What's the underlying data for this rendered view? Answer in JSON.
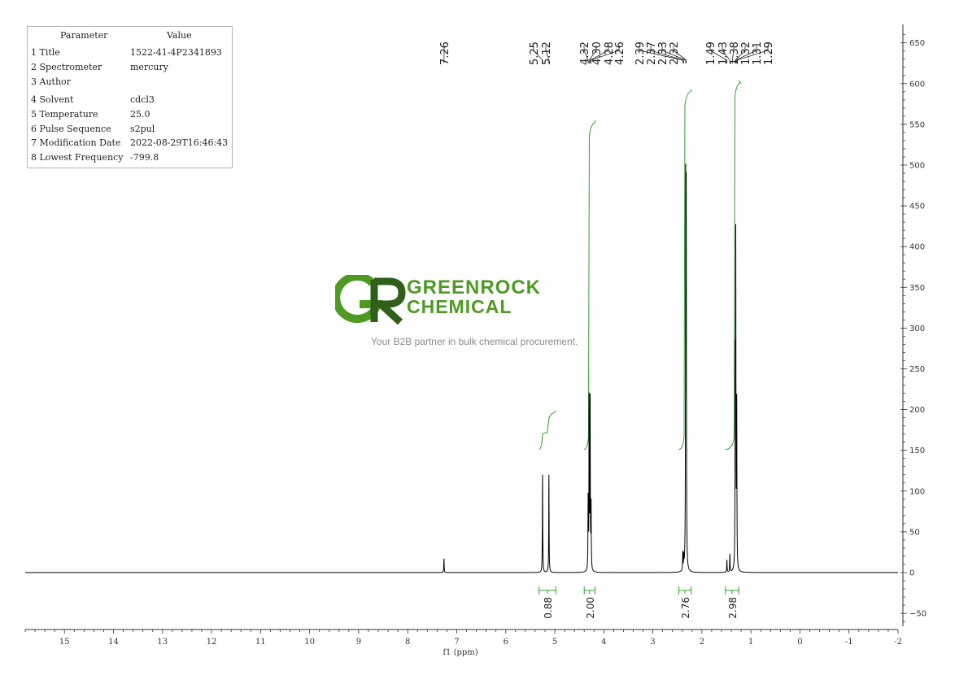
{
  "params": {
    "header": {
      "name": "Parameter",
      "value": "Value"
    },
    "rows": [
      {
        "key": "1 Title",
        "value": "1522-41-4P2341893"
      },
      {
        "key": "2 Spectrometer",
        "value": "mercury"
      },
      {
        "key": "3 Author",
        "value": ""
      },
      {
        "key": "4 Solvent",
        "value": "cdcl3"
      },
      {
        "key": "5 Temperature",
        "value": "25.0"
      },
      {
        "key": "6 Pulse Sequence",
        "value": "s2pul"
      },
      {
        "key": "7 Modification Date",
        "value": "2022-08-29T16:46:43"
      },
      {
        "key": "8 Lowest Frequency",
        "value": "-799.8"
      }
    ]
  },
  "logo": {
    "line1": "GREENROCK",
    "line2": "CHEMICAL",
    "tagline": "Your B2B partner in bulk chemical procurement."
  },
  "colors": {
    "spectrum": "#000000",
    "integral": "#2ca02c",
    "axis": "#333333",
    "logo_green": "#4e9a23",
    "logo_dark": "#2f5f1a"
  },
  "chart_data": {
    "type": "line",
    "title": "",
    "xlabel": "f1 (ppm)",
    "ylabel": "",
    "xlim": [
      15.8,
      -2.0
    ],
    "ylim": [
      -68,
      668
    ],
    "x_ticks": [
      15,
      14,
      13,
      12,
      11,
      10,
      9,
      8,
      7,
      6,
      5,
      4,
      3,
      2,
      1,
      0,
      -1,
      -2
    ],
    "y_ticks": [
      -50,
      0,
      50,
      100,
      150,
      200,
      250,
      300,
      350,
      400,
      450,
      500,
      550,
      600,
      650
    ],
    "peak_labels": [
      "7.26",
      "5.25",
      "5.12",
      "4.32",
      "4.30",
      "4.28",
      "4.26",
      "2.39",
      "2.37",
      "2.33",
      "2.32",
      "1.49",
      "1.43",
      "1.38",
      "1.32",
      "1.31",
      "1.29"
    ],
    "peaks": [
      {
        "ppm": 7.26,
        "height": 17
      },
      {
        "ppm": 5.25,
        "height": 120
      },
      {
        "ppm": 5.12,
        "height": 120
      },
      {
        "ppm": 4.32,
        "height": 85
      },
      {
        "ppm": 4.3,
        "height": 206
      },
      {
        "ppm": 4.28,
        "height": 205
      },
      {
        "ppm": 4.26,
        "height": 78
      },
      {
        "ppm": 2.39,
        "height": 22
      },
      {
        "ppm": 2.37,
        "height": 15
      },
      {
        "ppm": 2.33,
        "height": 430
      },
      {
        "ppm": 2.32,
        "height": 418
      },
      {
        "ppm": 1.49,
        "height": 15
      },
      {
        "ppm": 1.43,
        "height": 22
      },
      {
        "ppm": 1.32,
        "height": 215
      },
      {
        "ppm": 1.31,
        "height": 382
      },
      {
        "ppm": 1.29,
        "height": 196
      }
    ],
    "integrals": [
      {
        "from": 5.32,
        "to": 4.98,
        "value": "0.88"
      },
      {
        "from": 4.4,
        "to": 4.18,
        "value": "2.00"
      },
      {
        "from": 2.47,
        "to": 2.22,
        "value": "2.76"
      },
      {
        "from": 1.52,
        "to": 1.25,
        "value": "2.98"
      }
    ],
    "integral_curves": [
      {
        "from": 5.32,
        "to": 4.98,
        "base": 152,
        "top": 195,
        "step": [
          5.25,
          5.12
        ]
      },
      {
        "from": 4.4,
        "to": 4.18,
        "base": 152,
        "top": 551,
        "step": [
          4.28
        ]
      },
      {
        "from": 2.47,
        "to": 2.22,
        "base": 152,
        "top": 589,
        "step": [
          2.33
        ]
      },
      {
        "from": 1.52,
        "to": 1.25,
        "base": 152,
        "top": 600,
        "step": [
          1.31
        ]
      }
    ]
  }
}
